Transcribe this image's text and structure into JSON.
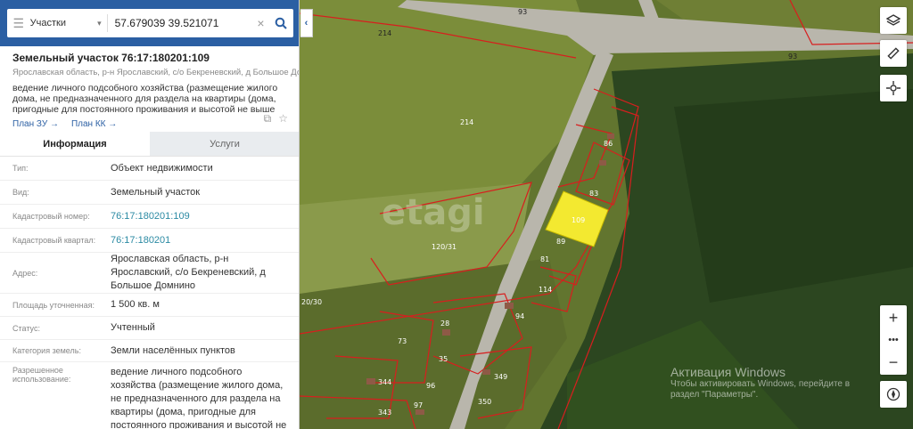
{
  "search": {
    "type_label": "Участки",
    "query": "57.679039 39.521071"
  },
  "plot": {
    "title": "Земельный участок 76:17:180201:109",
    "address": "Ярославская область, р-н Ярославский, с/о Бекреневский, д Большое Домнино",
    "description": "ведение личного подсобного хозяйства (размещение жилого дома, не предназначенного для раздела на квартиры (дома, пригодные для постоянного проживания и высотой не выше трех надземных...",
    "link_zu": "План ЗУ →",
    "link_kk": "План КК →"
  },
  "tabs": {
    "info": "Информация",
    "services": "Услуги"
  },
  "info": [
    {
      "key": "Тип:",
      "value": "Объект недвижимости"
    },
    {
      "key": "Вид:",
      "value": "Земельный участок"
    },
    {
      "key": "Кадастровый номер:",
      "value": "76:17:180201:109"
    },
    {
      "key": "Кадастровый квартал:",
      "value": "76:17:180201"
    },
    {
      "key": "Адрес:",
      "value": "Ярославская область, р-н Ярославский, с/о Бекреневский, д Большое Домнино"
    },
    {
      "key": "Площадь уточненная:",
      "value": "1 500 кв. м"
    },
    {
      "key": "Статус:",
      "value": "Учтенный"
    },
    {
      "key": "Категория земель:",
      "value": "Земли населённых пунктов"
    },
    {
      "key": "Разрешенное использование:",
      "value": "ведение личного подсобного хозяйства (размещение жилого дома, не предназначенного для раздела на квартиры (дома, пригодные для постоянного проживания и высотой не"
    }
  ],
  "map_labels": {
    "road_93a": "93",
    "road_93b": "93",
    "road_214": "214",
    "field_214": "214",
    "p86": "86",
    "p83": "83",
    "p109": "109",
    "p89": "89",
    "p81": "81",
    "p114": "114",
    "p120_31": "120/31",
    "p20_30": "20/30",
    "p94": "94",
    "p73": "73",
    "p28": "28",
    "p35": "35",
    "p96": "96",
    "p349": "349",
    "p344": "344",
    "p97": "97",
    "p350": "350",
    "p343": "343",
    "watermark_logo": "etagi"
  },
  "watermark": {
    "title": "Активация Windows",
    "text": "Чтобы активировать Windows, перейдите в раздел \"Параметры\"."
  },
  "colors": {
    "header_blue": "#2b5fa3",
    "link": "#2b8aa3",
    "boundary": "#d81e1e",
    "selected_plot": "#f3e930"
  }
}
